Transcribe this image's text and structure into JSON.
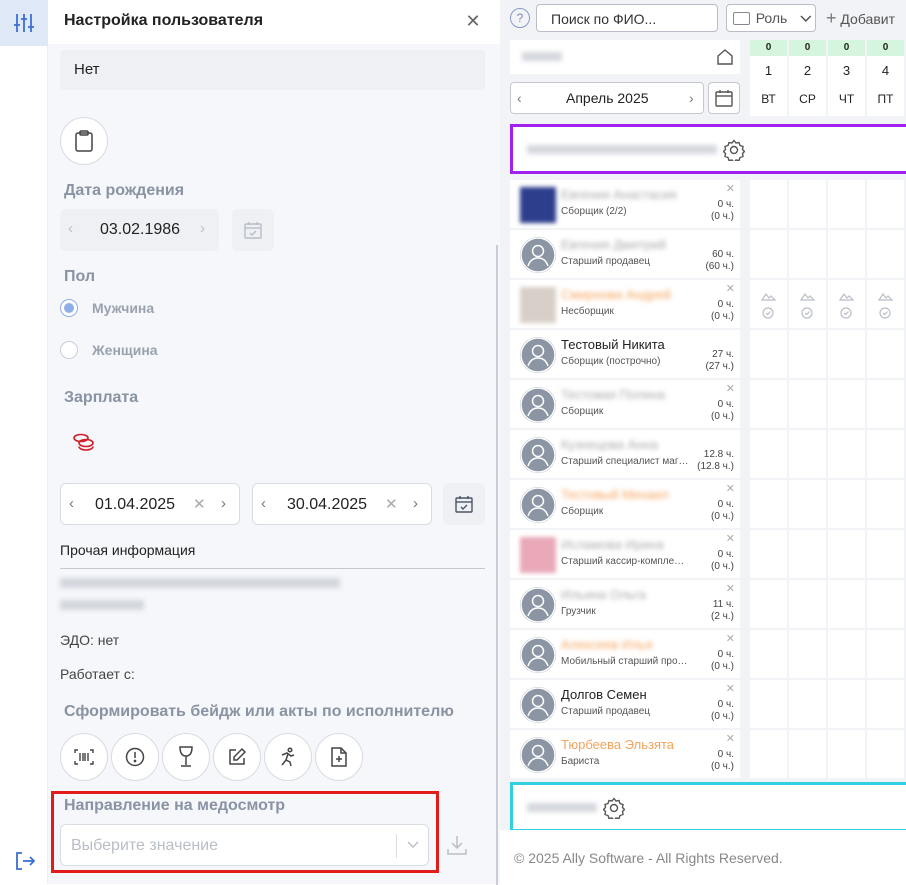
{
  "colors": {
    "accent": "#3b6fd4",
    "highlight_red": "#e21b1b",
    "group_purple": "#a020f0",
    "group_cyan": "#2fd0e0",
    "active_rail": "#dfe8f7"
  },
  "rail": {
    "active_icon": "sliders-icon",
    "logout_icon": "logout-icon"
  },
  "panel": {
    "title": "Настройка пользователя",
    "note_value": "Нет",
    "birth_label": "Дата рождения",
    "birth_date": "03.02.1986",
    "gender_label": "Пол",
    "gender_male": "Мужчина",
    "gender_female": "Женщина",
    "salary_label": "Зарплата",
    "date_from": "01.04.2025",
    "date_to": "30.04.2025",
    "other_info_label": "Прочая информация",
    "edo": "ЭДО: нет",
    "works_since": "Работает с:",
    "badge_title": "Сформировать бейдж или акты по исполнителю",
    "medical_label": "Направление на медосмотр",
    "medical_placeholder": "Выберите значение"
  },
  "toolbar": {
    "help": "?",
    "search_placeholder": "Поиск по ФИО...",
    "role_label": "Роль",
    "add_label": "Добавит"
  },
  "calendar": {
    "month": "Апрель 2025",
    "days": [
      {
        "count": "0",
        "num": "1",
        "name": "ВТ"
      },
      {
        "count": "0",
        "num": "2",
        "name": "СР"
      },
      {
        "count": "0",
        "num": "3",
        "name": "ЧТ"
      },
      {
        "count": "0",
        "num": "4",
        "name": "ПТ"
      }
    ]
  },
  "employees": [
    {
      "name": "Евгения Анастасия",
      "role": "Сборщик (2/2)",
      "h1": "0 ч.",
      "h2": "(0 ч.)"
    },
    {
      "name": "Евгения Дмитрий",
      "role": "Старший продавец",
      "h1": "60 ч.",
      "h2": "(60 ч.)"
    },
    {
      "name": "Смирнова Андрей",
      "role": "Несборщик",
      "h1": "0 ч.",
      "h2": "(0 ч.)"
    },
    {
      "name": "Тестовый Никита",
      "role": "Сборщик (построчно)",
      "h1": "27 ч.",
      "h2": "(27 ч.)"
    },
    {
      "name": "Тестовая Полина",
      "role": "Сборщик",
      "h1": "0 ч.",
      "h2": "(0 ч.)"
    },
    {
      "name": "Кузнецова Анна",
      "role": "Старший специалист маг…",
      "h1": "12.8 ч.",
      "h2": "(12.8 ч.)"
    },
    {
      "name": "Тестовый Михаил",
      "role": "Сборщик",
      "h1": "0 ч.",
      "h2": "(0 ч.)"
    },
    {
      "name": "Исламова Ирина",
      "role": "Старший кассир-компле…",
      "h1": "0 ч.",
      "h2": "(0 ч.)"
    },
    {
      "name": "Ильина Ольга",
      "role": "Грузчик",
      "h1": "11 ч.",
      "h2": "(2 ч.)"
    },
    {
      "name": "Алексеев Илья",
      "role": "Мобильный старший про…",
      "h1": "0 ч.",
      "h2": "(0 ч.)"
    },
    {
      "name": "Долгов Семен",
      "role": "Старший продавец",
      "h1": "0 ч.",
      "h2": "(0 ч.)"
    },
    {
      "name": "Тюрбеева Эльзята",
      "role": "Бариста",
      "h1": "0 ч.",
      "h2": "(0 ч.)"
    }
  ],
  "footer": "© 2025 Ally Software - All Rights Reserved."
}
